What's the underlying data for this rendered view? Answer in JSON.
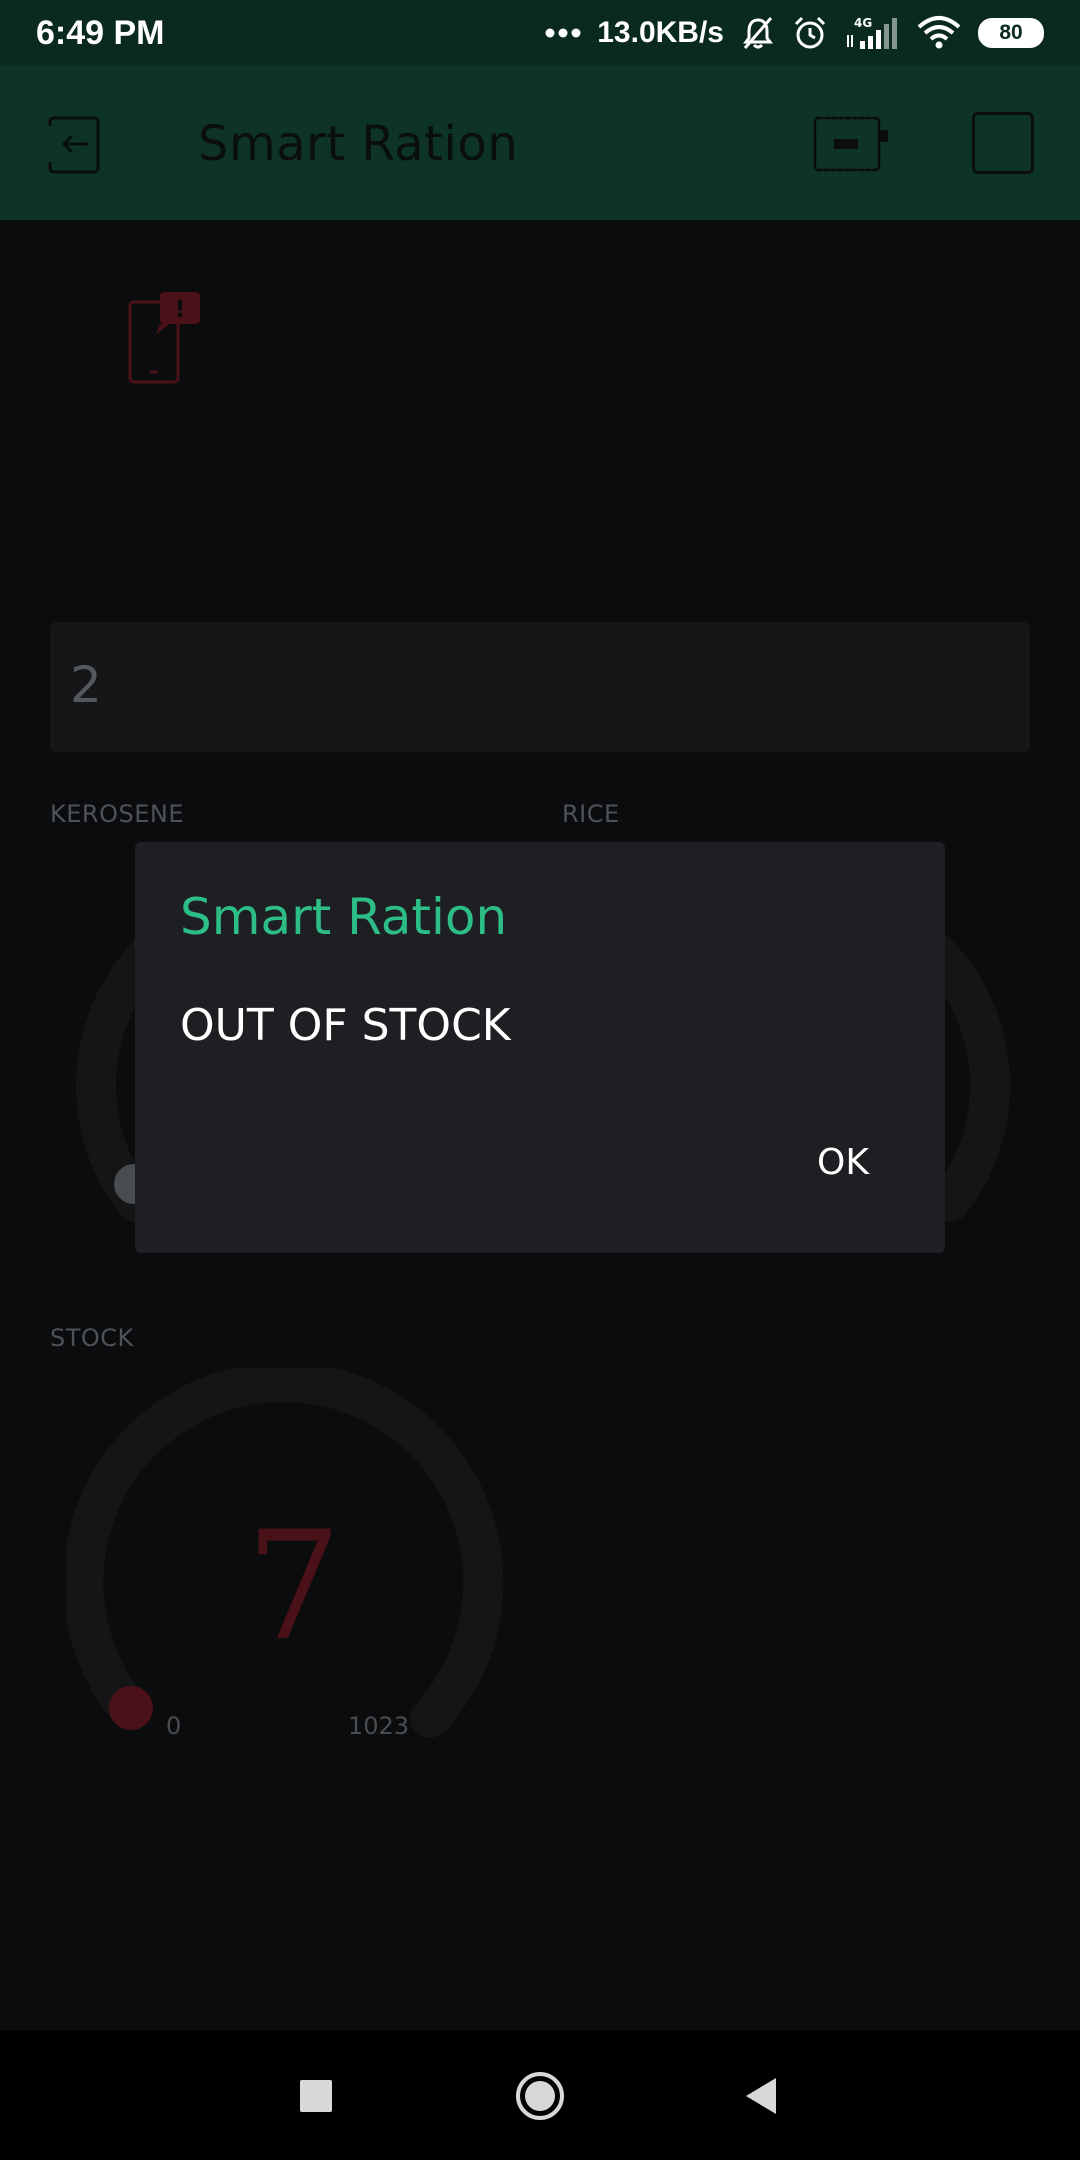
{
  "status_bar": {
    "time": "6:49 PM",
    "network_speed": "13.0KB/s",
    "network_type": "4G",
    "battery": "80",
    "icons": [
      "dots-icon",
      "mute-bell-icon",
      "alarm-icon",
      "signal-icon",
      "wifi-icon",
      "battery-icon"
    ]
  },
  "app_bar": {
    "title": "Smart Ration",
    "icons": [
      "exit-icon",
      "device-icon",
      "stop-icon"
    ]
  },
  "widgets": {
    "value_display": "2",
    "kerosene_label": "KEROSENE",
    "rice_label": "RICE",
    "stock_label": "STOCK",
    "stock_value": "7",
    "stock_min": "0",
    "stock_max": "1023"
  },
  "dialog": {
    "title": "Smart Ration",
    "message": "OUT OF STOCK",
    "ok_label": "OK"
  },
  "colors": {
    "accent": "#2dbd86",
    "appbar": "#0e3327",
    "statusbar": "#0a2a20",
    "gauge_value": "#4a1118",
    "dialog_bg": "#1e1f22"
  },
  "nav_bar": {
    "icons": [
      "recents-icon",
      "home-icon",
      "back-icon"
    ]
  }
}
